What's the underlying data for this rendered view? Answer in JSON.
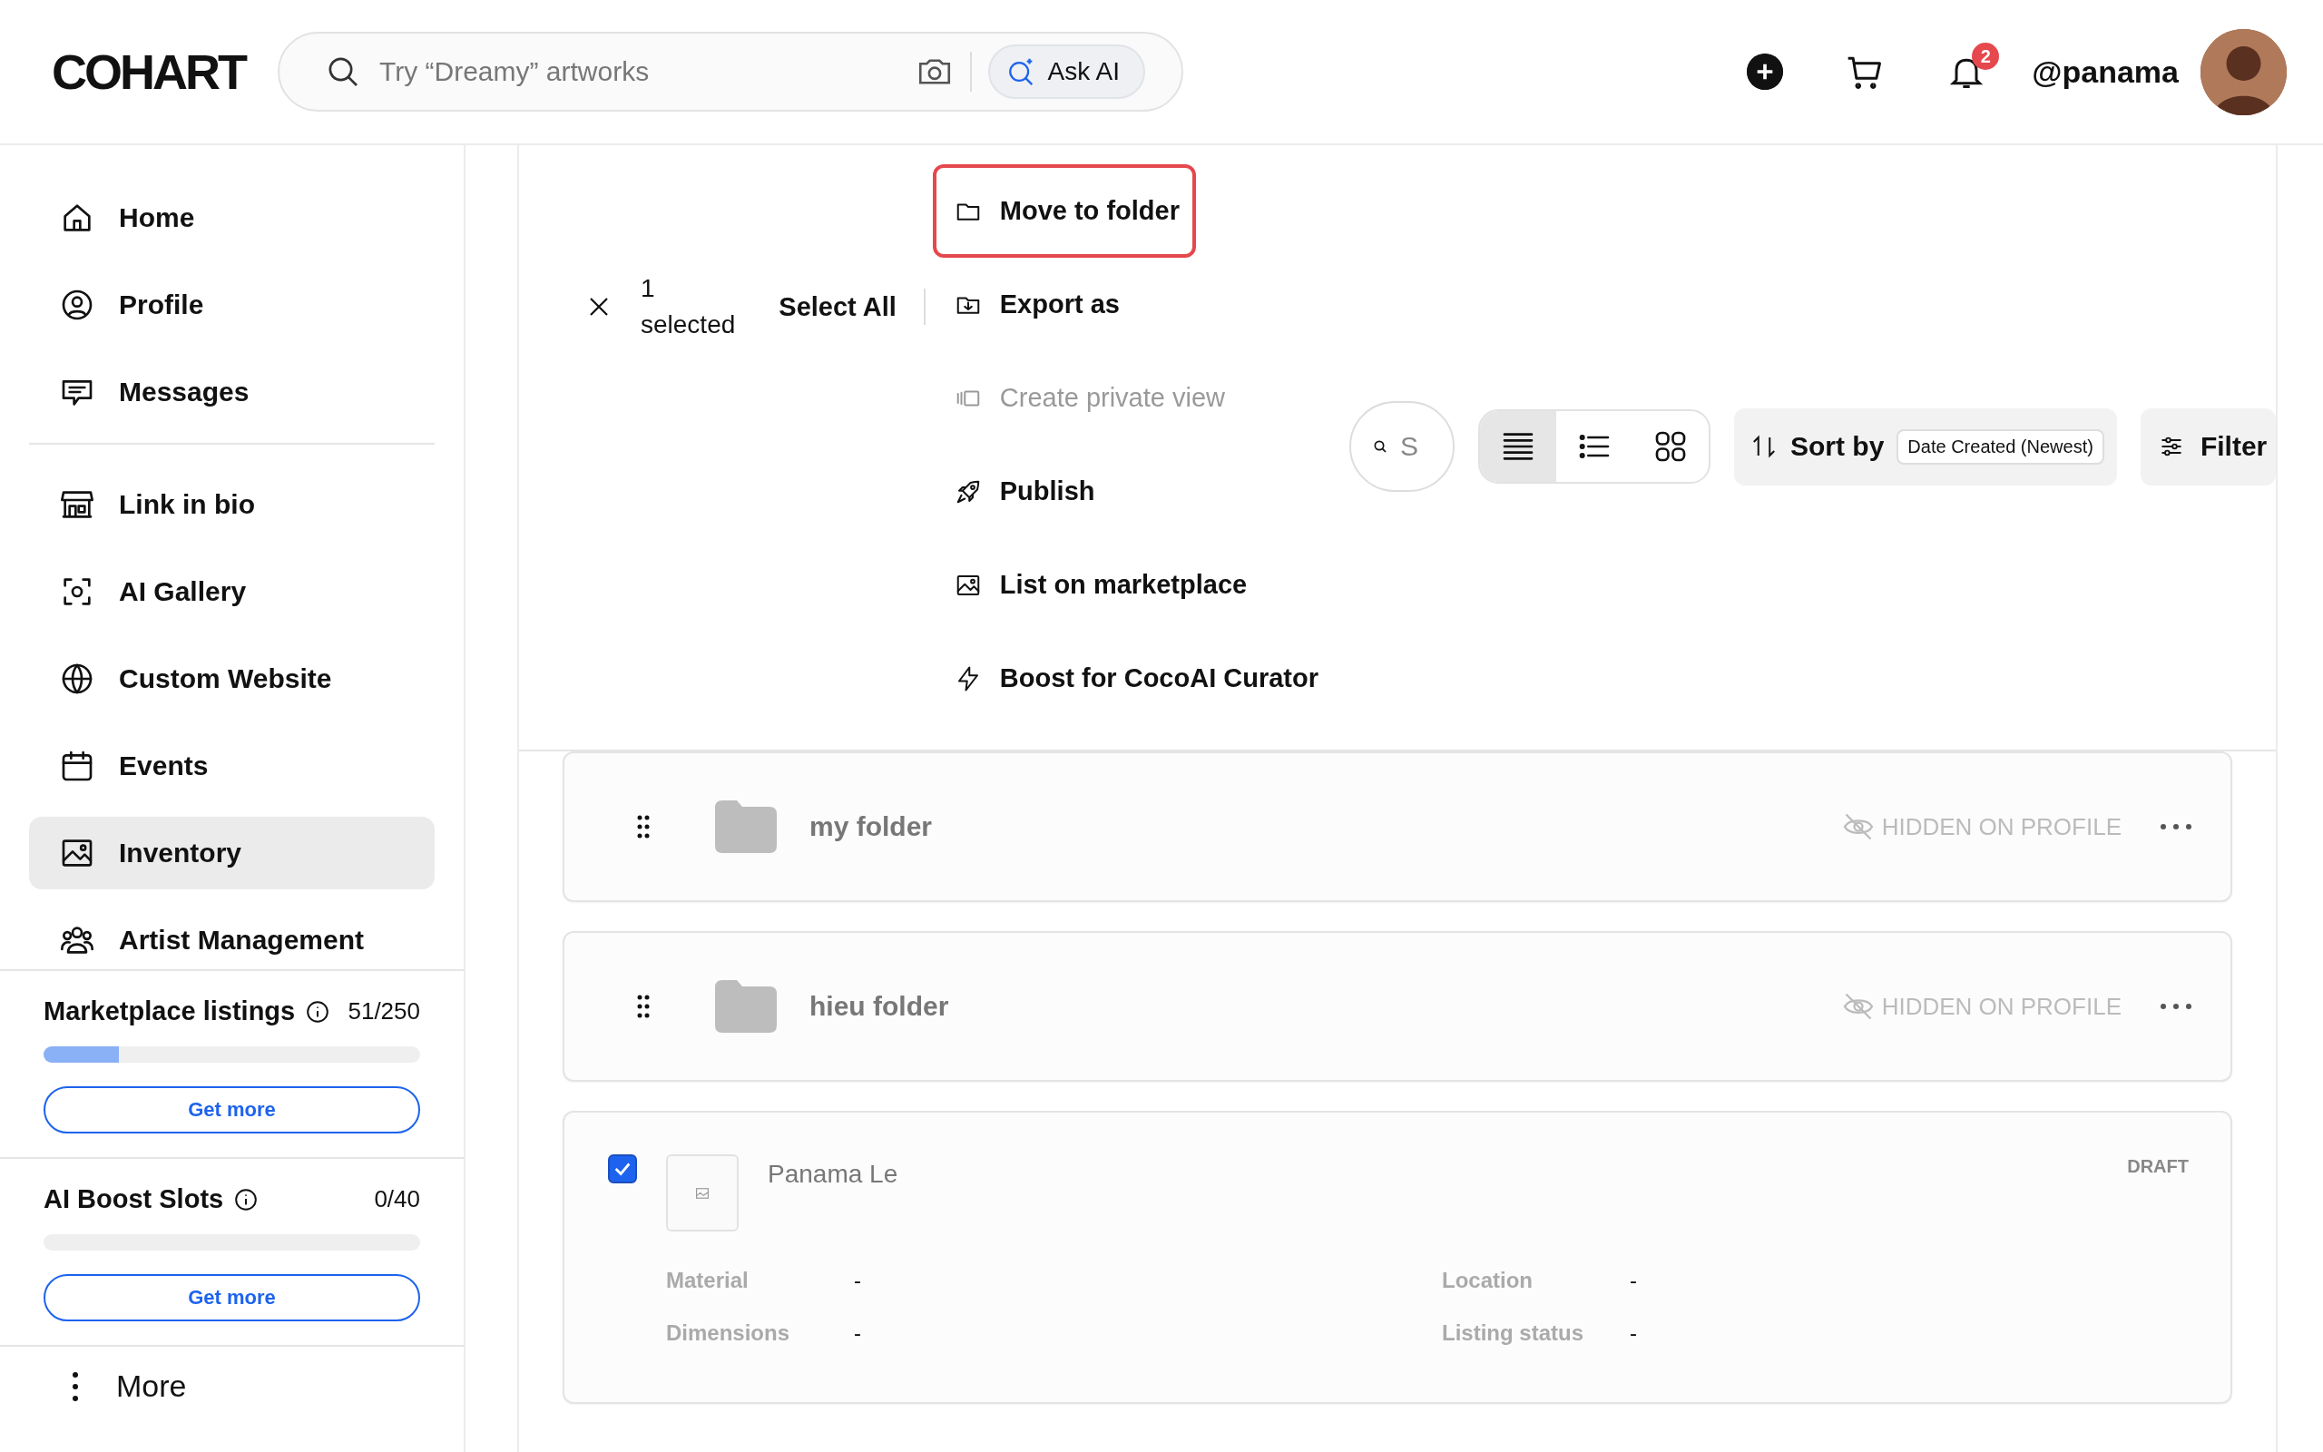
{
  "header": {
    "logo": "COHART",
    "search": {
      "placeholder": "Try “Dreamy” artworks"
    },
    "ask_ai": "Ask AI",
    "notification_count": "2",
    "username": "@panama"
  },
  "sidebar": {
    "groups": [
      {
        "items": [
          {
            "label": "Home",
            "selected": false
          },
          {
            "label": "Profile",
            "selected": false
          },
          {
            "label": "Messages",
            "selected": false
          }
        ]
      },
      {
        "items": [
          {
            "label": "Link in bio",
            "selected": false
          },
          {
            "label": "AI Gallery",
            "selected": false
          },
          {
            "label": "Custom Website",
            "selected": false
          },
          {
            "label": "Events",
            "selected": false
          },
          {
            "label": "Inventory",
            "selected": true
          },
          {
            "label": "Artist Management",
            "selected": false
          }
        ]
      }
    ],
    "quotas": [
      {
        "label": "Marketplace listings",
        "count": "51/250",
        "level": 0.2,
        "button": "Get more"
      },
      {
        "label": "AI Boost Slots",
        "count": "0/40",
        "level": 0,
        "button": "Get more"
      }
    ],
    "more": "More"
  },
  "toolbar": {
    "selected_count": "1",
    "selected_label": "selected",
    "select_all": "Select All",
    "actions": [
      {
        "label": "Move to folder",
        "highlighted": true,
        "disabled": false
      },
      {
        "label": "Export as",
        "highlighted": false,
        "disabled": false
      },
      {
        "label": "Create private view",
        "highlighted": false,
        "disabled": true
      },
      {
        "label": "Publish",
        "highlighted": false,
        "disabled": false
      },
      {
        "label": "List on marketplace",
        "highlighted": false,
        "disabled": false
      },
      {
        "label": "Boost for CocoAI Curator",
        "highlighted": false,
        "disabled": false
      }
    ],
    "search": {
      "placeholder": "S"
    },
    "views": [
      {
        "kind": "rows",
        "selected": true
      },
      {
        "kind": "list",
        "selected": false
      },
      {
        "kind": "grid",
        "selected": false
      }
    ],
    "sort": {
      "label": "Sort by",
      "value": "Date Created (Newest)"
    },
    "filter": "Filter"
  },
  "items": [
    {
      "kind": "folder",
      "name": "my folder",
      "visibility": "HIDDEN ON PROFILE"
    },
    {
      "kind": "folder",
      "name": "hieu folder",
      "visibility": "HIDDEN ON PROFILE"
    },
    {
      "kind": "artwork",
      "title": "Panama Le",
      "status": "DRAFT",
      "checked": true,
      "fields": [
        {
          "label": "Material",
          "value": "-"
        },
        {
          "label": "Location",
          "value": "-"
        },
        {
          "label": "Dimensions",
          "value": "-"
        },
        {
          "label": "Listing status",
          "value": "-"
        }
      ]
    }
  ]
}
